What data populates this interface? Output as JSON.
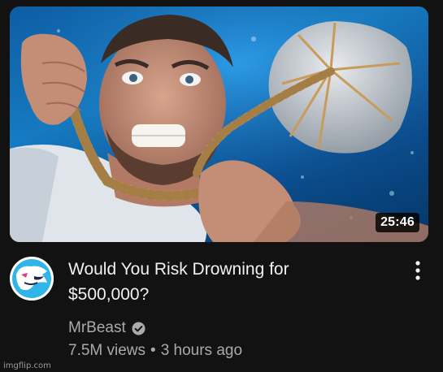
{
  "video": {
    "duration": "25:46",
    "title_line_1": "Would You Risk Drowning for",
    "title_line_2": "$500,000?",
    "channel": "MrBeast",
    "views": "7.5M views",
    "separator": "•",
    "posted": "3 hours ago"
  },
  "icons": {
    "avatar": "mrbeast-panther-logo",
    "verified": "verified-check-icon",
    "menu": "more-vert-icon"
  },
  "watermark": "imgflip.com",
  "colors": {
    "background": "#121212",
    "title": "#f1f1f1",
    "secondary_text": "#aaaaaa",
    "duration_badge": "#000000",
    "avatar_accent": "#2fb5e8"
  }
}
